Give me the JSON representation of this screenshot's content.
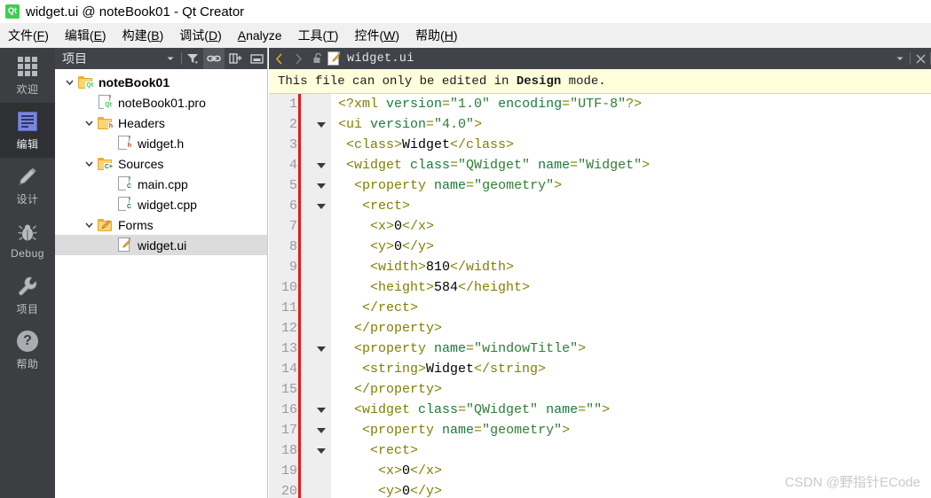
{
  "window": {
    "title": "widget.ui @ noteBook01 - Qt Creator",
    "logo_icon": "qt-logo-icon"
  },
  "menubar": {
    "items": [
      {
        "label": "文件(F)",
        "text": "文件(",
        "mnemonic": "F",
        "tail": ")"
      },
      {
        "label": "编辑(E)",
        "text": "编辑(",
        "mnemonic": "E",
        "tail": ")"
      },
      {
        "label": "构建(B)",
        "text": "构建(",
        "mnemonic": "B",
        "tail": ")"
      },
      {
        "label": "调试(D)",
        "text": "调试(",
        "mnemonic": "D",
        "tail": ")"
      },
      {
        "label": "Analyze",
        "text": "",
        "mnemonic": "A",
        "tail": "nalyze"
      },
      {
        "label": "工具(T)",
        "text": "工具(",
        "mnemonic": "T",
        "tail": ")"
      },
      {
        "label": "控件(W)",
        "text": "控件(",
        "mnemonic": "W",
        "tail": ")"
      },
      {
        "label": "帮助(H)",
        "text": "帮助(",
        "mnemonic": "H",
        "tail": ")"
      }
    ]
  },
  "modebar": {
    "items": [
      {
        "label": "欢迎",
        "icon": "grid-icon",
        "active": false
      },
      {
        "label": "编辑",
        "icon": "document-icon",
        "active": true
      },
      {
        "label": "设计",
        "icon": "pencil-icon",
        "active": false
      },
      {
        "label": "Debug",
        "icon": "bug-icon",
        "active": false
      },
      {
        "label": "项目",
        "icon": "wrench-icon",
        "active": false
      },
      {
        "label": "帮助",
        "icon": "question-mark-icon",
        "active": false
      }
    ]
  },
  "project_panel": {
    "title": "项目",
    "toolbar": [
      {
        "icon": "chevron-down-icon",
        "pressed": false
      },
      {
        "icon": "filter-icon",
        "pressed": false
      },
      {
        "icon": "link-icon",
        "pressed": true
      },
      {
        "icon": "split-add-icon",
        "pressed": false
      },
      {
        "icon": "collapse-icon",
        "pressed": false
      }
    ],
    "tree": [
      {
        "label": "noteBook01",
        "indent": 0,
        "arrow": "down",
        "icon": "qt-project-folder-icon",
        "bold": true,
        "selected": false
      },
      {
        "label": "noteBook01.pro",
        "indent": 1,
        "arrow": "none",
        "icon": "qt-pro-file-icon",
        "bold": false,
        "selected": false
      },
      {
        "label": "Headers",
        "indent": 1,
        "arrow": "down",
        "icon": "headers-folder-icon",
        "bold": false,
        "selected": false
      },
      {
        "label": "widget.h",
        "indent": 2,
        "arrow": "none",
        "icon": "header-file-icon",
        "bold": false,
        "selected": false
      },
      {
        "label": "Sources",
        "indent": 1,
        "arrow": "down",
        "icon": "sources-folder-icon",
        "bold": false,
        "selected": false
      },
      {
        "label": "main.cpp",
        "indent": 2,
        "arrow": "none",
        "icon": "cpp-file-icon",
        "bold": false,
        "selected": false
      },
      {
        "label": "widget.cpp",
        "indent": 2,
        "arrow": "none",
        "icon": "cpp-file-icon",
        "bold": false,
        "selected": false
      },
      {
        "label": "Forms",
        "indent": 1,
        "arrow": "down",
        "icon": "forms-folder-icon",
        "bold": false,
        "selected": false
      },
      {
        "label": "widget.ui",
        "indent": 2,
        "arrow": "none",
        "icon": "ui-file-icon",
        "bold": false,
        "selected": true
      }
    ]
  },
  "editor": {
    "tabbar": {
      "back_icon": "chevron-left-icon",
      "forward_icon": "chevron-right-icon",
      "lock_icon": "unlock-icon",
      "file_icon": "ui-file-icon",
      "filename": "widget.ui",
      "dropdown_icon": "chevron-down-icon",
      "close_icon": "close-icon"
    },
    "infobar": {
      "prefix": "This file can only be edited in ",
      "emphasis": "Design",
      "suffix": " mode."
    },
    "lines": [
      {
        "n": "1",
        "fold": false,
        "tokens": [
          {
            "t": "tag",
            "v": "<?xml "
          },
          {
            "t": "attr",
            "v": "version"
          },
          {
            "t": "tag",
            "v": "="
          },
          {
            "t": "val",
            "v": "\"1.0\""
          },
          {
            "t": "tag",
            "v": " "
          },
          {
            "t": "attr",
            "v": "encoding"
          },
          {
            "t": "tag",
            "v": "="
          },
          {
            "t": "val",
            "v": "\"UTF-8\""
          },
          {
            "t": "tag",
            "v": "?>"
          }
        ]
      },
      {
        "n": "2",
        "fold": true,
        "tokens": [
          {
            "t": "tag",
            "v": "<ui "
          },
          {
            "t": "attr",
            "v": "version"
          },
          {
            "t": "tag",
            "v": "="
          },
          {
            "t": "val",
            "v": "\"4.0\""
          },
          {
            "t": "tag",
            "v": ">"
          }
        ]
      },
      {
        "n": "3",
        "fold": false,
        "tokens": [
          {
            "t": "tag",
            "v": " <class>"
          },
          {
            "t": "txt",
            "v": "Widget"
          },
          {
            "t": "tag",
            "v": "</class>"
          }
        ]
      },
      {
        "n": "4",
        "fold": true,
        "tokens": [
          {
            "t": "tag",
            "v": " <widget "
          },
          {
            "t": "attr",
            "v": "class"
          },
          {
            "t": "tag",
            "v": "="
          },
          {
            "t": "val",
            "v": "\"QWidget\""
          },
          {
            "t": "tag",
            "v": " "
          },
          {
            "t": "attr",
            "v": "name"
          },
          {
            "t": "tag",
            "v": "="
          },
          {
            "t": "val",
            "v": "\"Widget\""
          },
          {
            "t": "tag",
            "v": ">"
          }
        ]
      },
      {
        "n": "5",
        "fold": true,
        "tokens": [
          {
            "t": "tag",
            "v": "  <property "
          },
          {
            "t": "attr",
            "v": "name"
          },
          {
            "t": "tag",
            "v": "="
          },
          {
            "t": "val",
            "v": "\"geometry\""
          },
          {
            "t": "tag",
            "v": ">"
          }
        ]
      },
      {
        "n": "6",
        "fold": true,
        "tokens": [
          {
            "t": "tag",
            "v": "   <rect>"
          }
        ]
      },
      {
        "n": "7",
        "fold": false,
        "tokens": [
          {
            "t": "tag",
            "v": "    <x>"
          },
          {
            "t": "txt",
            "v": "0"
          },
          {
            "t": "tag",
            "v": "</x>"
          }
        ]
      },
      {
        "n": "8",
        "fold": false,
        "tokens": [
          {
            "t": "tag",
            "v": "    <y>"
          },
          {
            "t": "txt",
            "v": "0"
          },
          {
            "t": "tag",
            "v": "</y>"
          }
        ]
      },
      {
        "n": "9",
        "fold": false,
        "tokens": [
          {
            "t": "tag",
            "v": "    <width>"
          },
          {
            "t": "txt",
            "v": "810"
          },
          {
            "t": "tag",
            "v": "</width>"
          }
        ]
      },
      {
        "n": "10",
        "fold": false,
        "tokens": [
          {
            "t": "tag",
            "v": "    <height>"
          },
          {
            "t": "txt",
            "v": "584"
          },
          {
            "t": "tag",
            "v": "</height>"
          }
        ]
      },
      {
        "n": "11",
        "fold": false,
        "tokens": [
          {
            "t": "tag",
            "v": "   </rect>"
          }
        ]
      },
      {
        "n": "12",
        "fold": false,
        "tokens": [
          {
            "t": "tag",
            "v": "  </property>"
          }
        ]
      },
      {
        "n": "13",
        "fold": true,
        "tokens": [
          {
            "t": "tag",
            "v": "  <property "
          },
          {
            "t": "attr",
            "v": "name"
          },
          {
            "t": "tag",
            "v": "="
          },
          {
            "t": "val",
            "v": "\"windowTitle\""
          },
          {
            "t": "tag",
            "v": ">"
          }
        ]
      },
      {
        "n": "14",
        "fold": false,
        "tokens": [
          {
            "t": "tag",
            "v": "   <string>"
          },
          {
            "t": "txt",
            "v": "Widget"
          },
          {
            "t": "tag",
            "v": "</string>"
          }
        ]
      },
      {
        "n": "15",
        "fold": false,
        "tokens": [
          {
            "t": "tag",
            "v": "  </property>"
          }
        ]
      },
      {
        "n": "16",
        "fold": true,
        "tokens": [
          {
            "t": "tag",
            "v": "  <widget "
          },
          {
            "t": "attr",
            "v": "class"
          },
          {
            "t": "tag",
            "v": "="
          },
          {
            "t": "val",
            "v": "\"QWidget\""
          },
          {
            "t": "tag",
            "v": " "
          },
          {
            "t": "attr",
            "v": "name"
          },
          {
            "t": "tag",
            "v": "="
          },
          {
            "t": "val",
            "v": "\"\""
          },
          {
            "t": "tag",
            "v": ">"
          }
        ]
      },
      {
        "n": "17",
        "fold": true,
        "tokens": [
          {
            "t": "tag",
            "v": "   <property "
          },
          {
            "t": "attr",
            "v": "name"
          },
          {
            "t": "tag",
            "v": "="
          },
          {
            "t": "val",
            "v": "\"geometry\""
          },
          {
            "t": "tag",
            "v": ">"
          }
        ]
      },
      {
        "n": "18",
        "fold": true,
        "tokens": [
          {
            "t": "tag",
            "v": "    <rect>"
          }
        ]
      },
      {
        "n": "19",
        "fold": false,
        "tokens": [
          {
            "t": "tag",
            "v": "     <x>"
          },
          {
            "t": "txt",
            "v": "0"
          },
          {
            "t": "tag",
            "v": "</x>"
          }
        ]
      },
      {
        "n": "20",
        "fold": false,
        "tokens": [
          {
            "t": "tag",
            "v": "     <y>"
          },
          {
            "t": "txt",
            "v": "0"
          },
          {
            "t": "tag",
            "v": "</y>"
          }
        ]
      }
    ]
  },
  "watermark": {
    "text": "CSDN @野指针ECode"
  },
  "colors": {
    "titlebar_bg": "#ffffff",
    "menubar_bg": "#f0f0f0",
    "modebar_bg": "#3c3e41",
    "modebar_active_bg": "#2e3033",
    "panel_header_bg": "#404448",
    "infobar_bg": "#ffffdc",
    "gutter_bg": "#eeeeee",
    "modified_marker": "#e01b1b",
    "tag_color": "#808000",
    "attr_color": "#1a7a3c",
    "value_color": "#2e7d32",
    "selection_bg": "#dcdcdc",
    "qt_green": "#41cd52",
    "nav_active": "#e0a82e"
  }
}
